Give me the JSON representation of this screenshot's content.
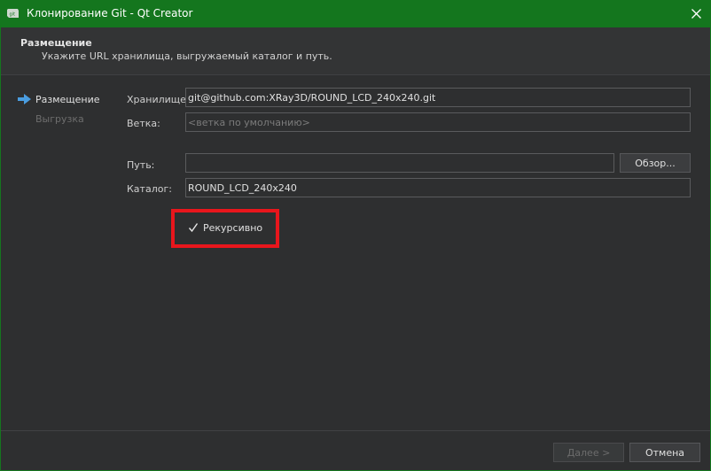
{
  "window": {
    "title": "Клонирование Git - Qt Creator",
    "accent_color": "#14761e",
    "app_icon": "qt-creator-icon",
    "close_icon": "close-icon"
  },
  "header": {
    "title": "Размещение",
    "subtitle": "Укажите URL хранилища, выгружаемый каталог и путь."
  },
  "sidebar": {
    "steps": [
      {
        "label": "Размещение",
        "active": true
      },
      {
        "label": "Выгрузка",
        "active": false
      }
    ]
  },
  "form": {
    "repository": {
      "label": "Хранилище:",
      "value": "git@github.com:XRay3D/ROUND_LCD_240x240.git"
    },
    "branch": {
      "label": "Ветка:",
      "placeholder": "<ветка по умолчанию>"
    },
    "path": {
      "label": "Путь:",
      "value": ""
    },
    "browse_button": "Обзор...",
    "directory": {
      "label": "Каталог:",
      "value": "ROUND_LCD_240x240"
    },
    "recursive": {
      "label": "Рекурсивно",
      "checked": true
    }
  },
  "footer": {
    "next_button": "Далее >",
    "cancel_button": "Отмена"
  },
  "annotation": {
    "highlight_color": "#e8161c"
  }
}
